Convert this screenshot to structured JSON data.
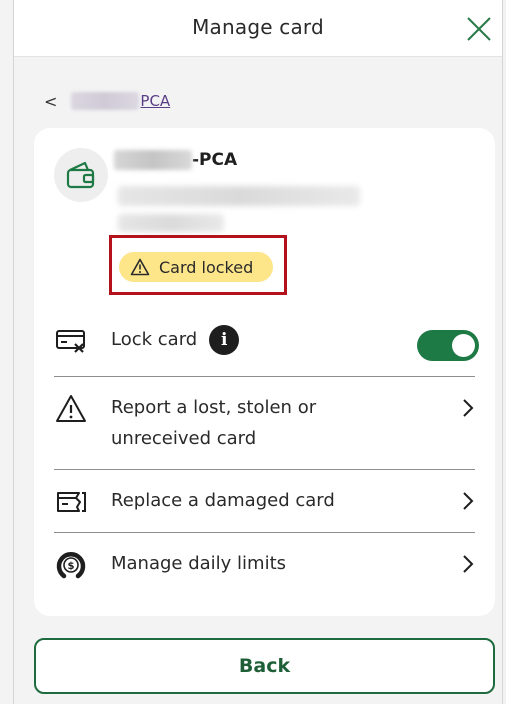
{
  "header": {
    "title": "Manage card",
    "close_icon": "close-icon"
  },
  "breadcrumb": {
    "chevron": "<",
    "account_suffix": "PCA"
  },
  "account": {
    "name_suffix": "-PCA",
    "status_badge": "Card locked",
    "icon": "wallet-icon"
  },
  "options": [
    {
      "label": "Lock card",
      "icon": "card-lock-icon",
      "has_info": true,
      "toggle_on": true
    },
    {
      "label_line1": "Report a lost, stolen or",
      "label_line2": "unreceived card",
      "icon": "warning-icon"
    },
    {
      "label": "Replace a damaged card",
      "icon": "damaged-card-icon"
    },
    {
      "label": "Manage daily limits",
      "icon": "daily-limit-icon"
    }
  ],
  "info_glyph": "i",
  "back_button": {
    "label": "Back"
  },
  "colors": {
    "brand_green": "#1e7a45",
    "badge_yellow": "#fde58a",
    "highlight_red": "#b3121c",
    "link_purple": "#5a3d87"
  }
}
